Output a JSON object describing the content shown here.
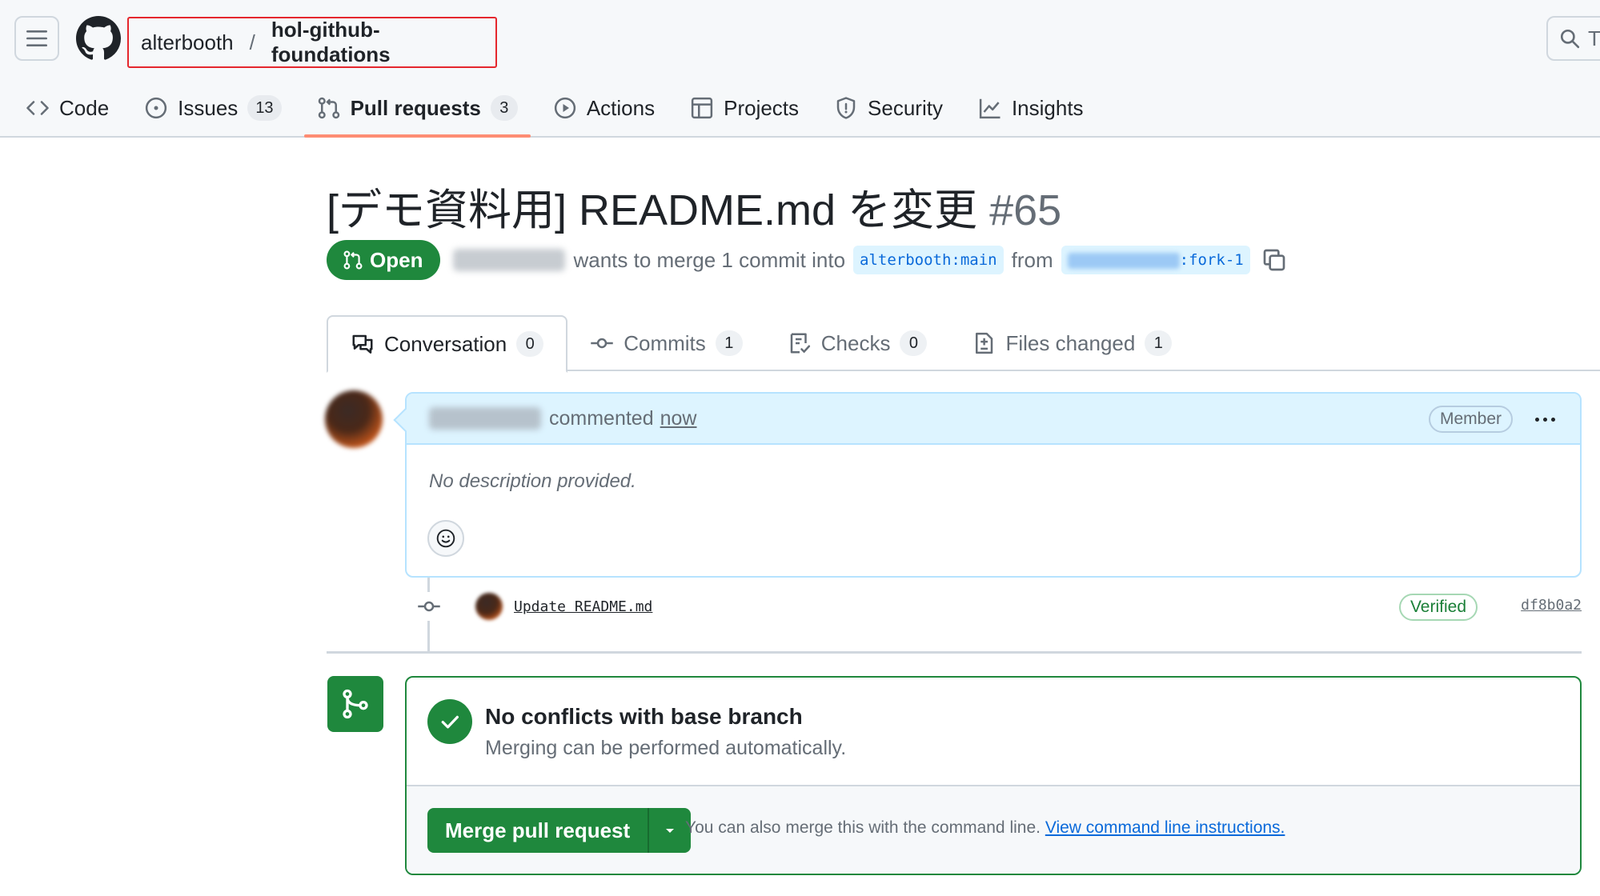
{
  "header": {
    "owner": "alterbooth",
    "separator": "/",
    "repo": "hol-github-foundations",
    "search_placeholder": "T"
  },
  "repo_tabs": [
    {
      "label": "Code",
      "icon": "code-icon"
    },
    {
      "label": "Issues",
      "icon": "issue-opened-icon",
      "count": "13"
    },
    {
      "label": "Pull requests",
      "icon": "git-pull-request-icon",
      "count": "3",
      "active": true
    },
    {
      "label": "Actions",
      "icon": "play-icon"
    },
    {
      "label": "Projects",
      "icon": "table-icon"
    },
    {
      "label": "Security",
      "icon": "shield-icon"
    },
    {
      "label": "Insights",
      "icon": "graph-icon"
    }
  ],
  "pr": {
    "title": "[デモ資料用] README.md を変更",
    "number": "#65",
    "state": "Open",
    "merge_text": "wants to merge 1 commit into",
    "base_branch": "alterbooth:main",
    "from_text": "from",
    "head_branch_suffix": ":fork-1"
  },
  "pr_tabs": [
    {
      "label": "Conversation",
      "count": "0",
      "icon": "comment-discussion-icon",
      "active": true
    },
    {
      "label": "Commits",
      "count": "1",
      "icon": "git-commit-icon"
    },
    {
      "label": "Checks",
      "count": "0",
      "icon": "checklist-icon"
    },
    {
      "label": "Files changed",
      "count": "1",
      "icon": "file-diff-icon"
    }
  ],
  "comment": {
    "action": "commented",
    "time": "now",
    "role_badge": "Member",
    "body": "No description provided."
  },
  "commit": {
    "message": "Update README.md",
    "badge": "Verified",
    "sha": "df8b0a2"
  },
  "merge": {
    "title": "No conflicts with base branch",
    "subtitle": "Merging can be performed automatically.",
    "button_label": "Merge pull request",
    "note": "You can also merge this with the command line.",
    "link_text": "View command line instructions."
  },
  "colors": {
    "accent_green": "#1f883d",
    "tab_underline": "#fd8c73",
    "highlight_box": "#e5272d",
    "link_blue": "#0969da"
  }
}
